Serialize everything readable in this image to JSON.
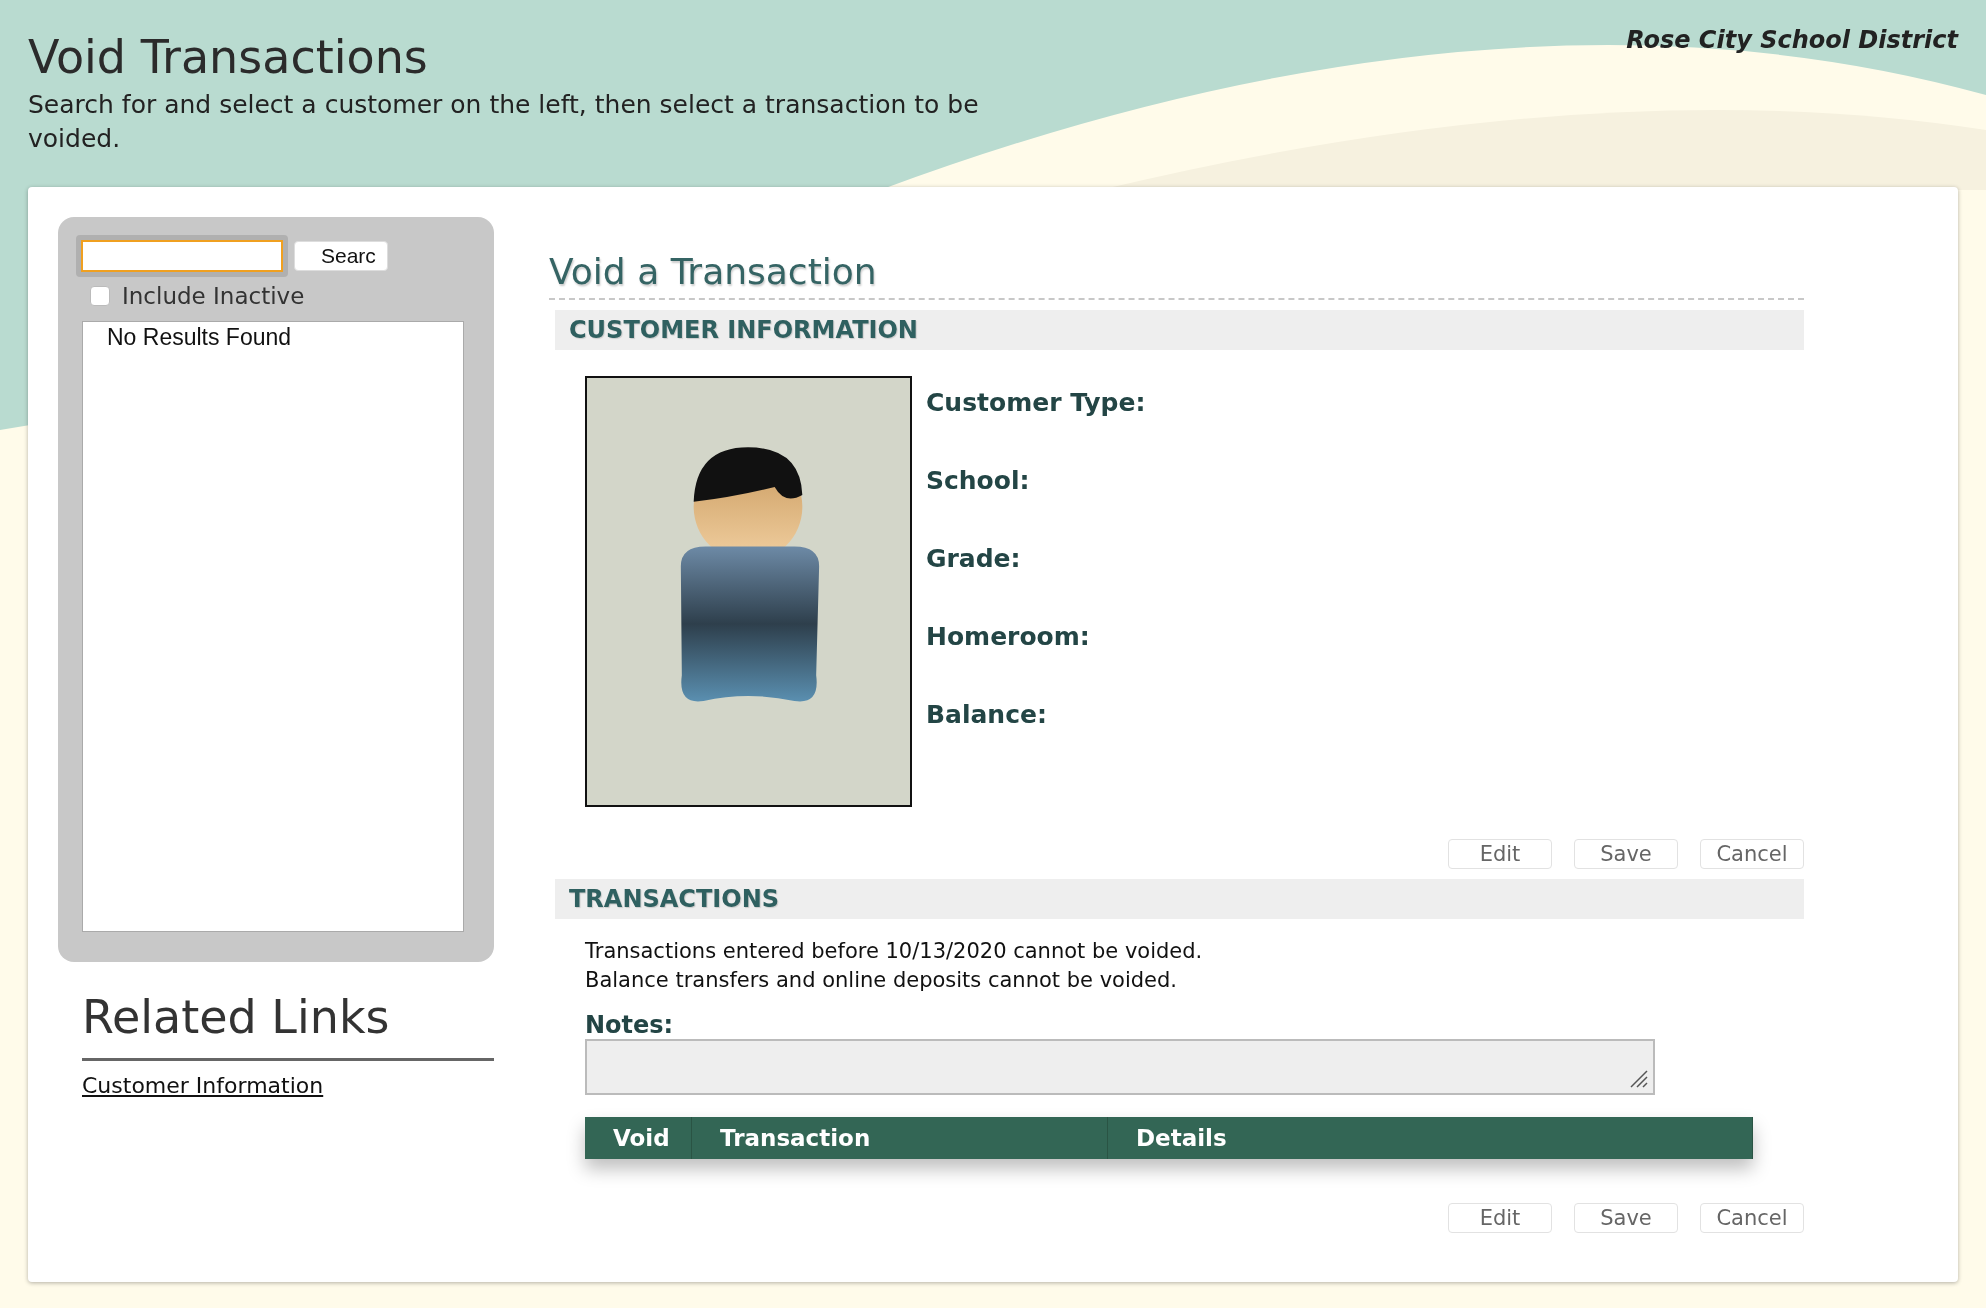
{
  "header": {
    "title": "Void Transactions",
    "subtitle": "Search for and select a customer on the left, then select a transaction to be voided.",
    "district": "Rose City School District"
  },
  "search_panel": {
    "search_button": "Searc",
    "include_inactive": {
      "label": "Include Inactive",
      "checked": false
    },
    "results_message": "No Results Found"
  },
  "related_links": {
    "title": "Related Links",
    "links": [
      "Customer Information"
    ]
  },
  "main": {
    "title": "Void a Transaction",
    "customer_information": {
      "heading": "CUSTOMER INFORMATION",
      "fields": [
        "Customer Type:",
        "School:",
        "Grade:",
        "Homeroom:",
        "Balance:"
      ],
      "buttons": [
        "Edit",
        "Save",
        "Cancel"
      ]
    },
    "transactions": {
      "heading": "TRANSACTIONS",
      "notices": [
        "Transactions entered before 10/13/2020 cannot be voided.",
        "Balance transfers and online deposits cannot be voided."
      ],
      "notes_label": "Notes:",
      "columns": [
        "Void",
        "Transaction",
        "Details"
      ],
      "buttons": [
        "Edit",
        "Save",
        "Cancel"
      ]
    }
  }
}
